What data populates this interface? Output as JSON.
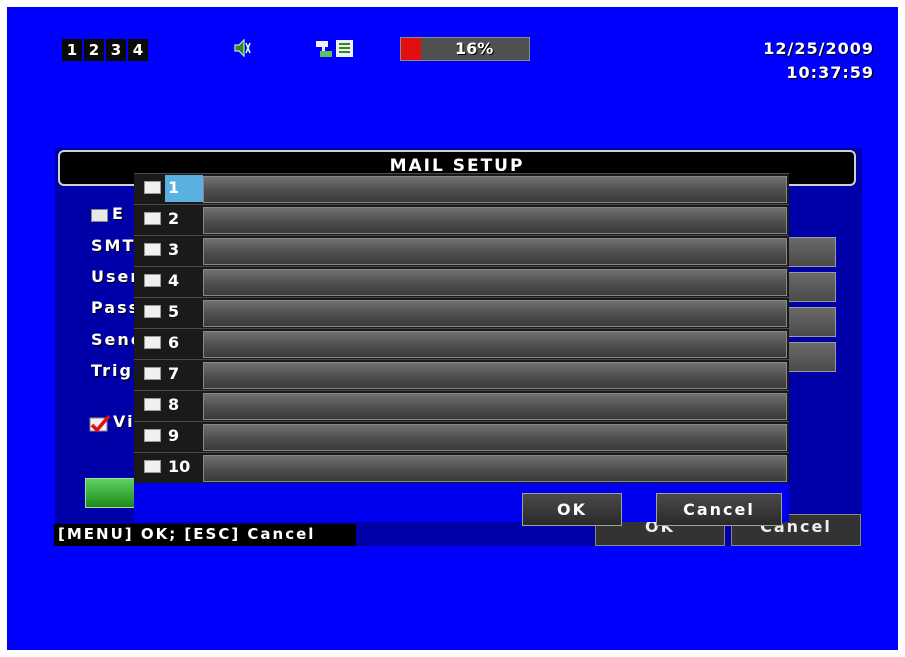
{
  "status": {
    "channels": [
      "1",
      "2",
      "3",
      "4"
    ],
    "icons": [
      "speaker-icon",
      "network-icon",
      "record-icon"
    ],
    "hdd_usage_text": "16%",
    "hdd_usage_fraction": 0.16,
    "date": "12/25/2009",
    "time": "10:37:59",
    "accent_color": "#e01010"
  },
  "mail_setup": {
    "title": "MAIL SETUP",
    "labels": [
      "E",
      "SMT",
      "User",
      "Pass",
      "Senc",
      "Trig",
      "Vi"
    ],
    "hint": "[MENU] OK; [ESC] Cancel",
    "ok_label": "OK",
    "cancel_label": "Cancel"
  },
  "list_popup": {
    "items": [
      {
        "number": "1",
        "value": ""
      },
      {
        "number": "2",
        "value": ""
      },
      {
        "number": "3",
        "value": ""
      },
      {
        "number": "4",
        "value": ""
      },
      {
        "number": "5",
        "value": ""
      },
      {
        "number": "6",
        "value": ""
      },
      {
        "number": "7",
        "value": ""
      },
      {
        "number": "8",
        "value": ""
      },
      {
        "number": "9",
        "value": ""
      },
      {
        "number": "10",
        "value": ""
      }
    ],
    "ok_label": "OK",
    "cancel_label": "Cancel"
  }
}
